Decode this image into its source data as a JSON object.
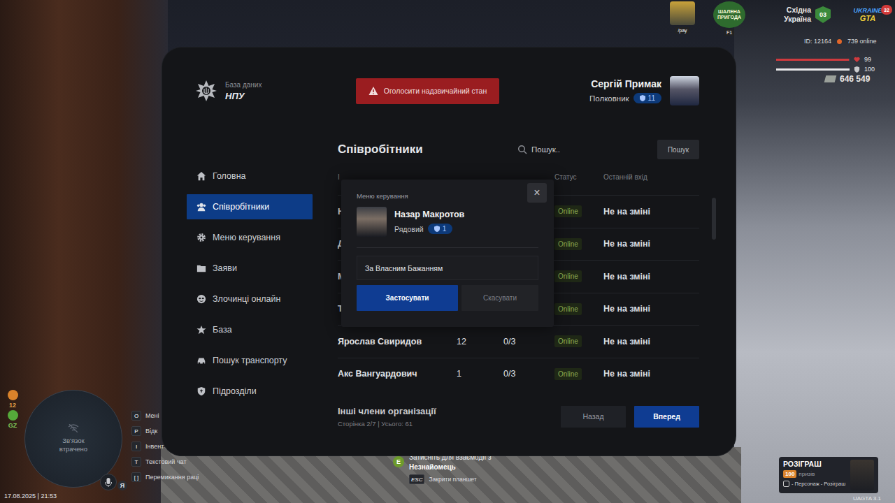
{
  "tablet": {
    "brand": {
      "subtitle": "База даних",
      "title": "НПУ"
    },
    "emergency_button": "Оголосити надзвичайний стан",
    "user": {
      "name": "Сергій Примак",
      "rank": "Полковник",
      "level": "11"
    },
    "sidebar": {
      "items": [
        {
          "label": "Головна",
          "selected": false
        },
        {
          "label": "Співробітники",
          "selected": true
        },
        {
          "label": "Меню керування",
          "selected": false
        },
        {
          "label": "Заяви",
          "selected": false
        },
        {
          "label": "Злочинці онлайн",
          "selected": false
        },
        {
          "label": "База",
          "selected": false
        },
        {
          "label": "Пошук транспорту",
          "selected": false
        },
        {
          "label": "Підрозділи",
          "selected": false
        }
      ]
    },
    "page": {
      "title": "Співробітники",
      "search": {
        "placeholder": "Пошук..",
        "button": "Пошук"
      }
    },
    "table": {
      "header": {
        "name": "І",
        "status": "Статус",
        "last_login": "Останній вхід"
      },
      "rows": [
        {
          "name": "Н",
          "status": "Online",
          "last_login": "Не на зміні"
        },
        {
          "name": "Д",
          "status": "Online",
          "last_login": "Не на зміні"
        },
        {
          "name": "М",
          "status": "Online",
          "last_login": "Не на зміні"
        },
        {
          "name": "Т",
          "status": "Online",
          "last_login": "Не на зміні"
        },
        {
          "name": "Ярослав Свиридов",
          "rank": "12",
          "warnings": "0/3",
          "status": "Online",
          "last_login": "Не на зміні"
        },
        {
          "name": "Акс Вангуардович",
          "rank": "1",
          "warnings": "0/3",
          "status": "Online",
          "last_login": "Не на зміні"
        }
      ]
    },
    "footer": {
      "title": "Інші члени організації",
      "pagination": "Сторінка 2/7 | Усього: 61",
      "prev": "Назад",
      "next": "Вперед"
    }
  },
  "modal": {
    "title": "Меню керування",
    "close": "×",
    "member": {
      "name": "Назар Макротов",
      "rank": "Рядовий",
      "level": "1"
    },
    "reason": "За Власним Бажанням",
    "apply": "Застосувати",
    "cancel": "Скасувати"
  },
  "hud": {
    "pay_label": "/pay",
    "adventure": {
      "title": "ШАЛЕНА ПРИГОДА",
      "key": "F1"
    },
    "region": {
      "name": "Східна Україна",
      "number": "03"
    },
    "logo": {
      "lines": [
        "UKRAINE",
        "GTA"
      ],
      "badge": "32"
    },
    "player_id": "ID: 12164",
    "online": "739 online",
    "health": {
      "value": "99",
      "level": 0.99
    },
    "armor": {
      "value": "100",
      "level": 1
    },
    "money": "646 549",
    "stats": [
      "12",
      "GZ"
    ],
    "minimap": "Зв'язок втрачено",
    "keys": [
      {
        "key": "O",
        "label": "Мені"
      },
      {
        "key": "P",
        "label": "Відк"
      },
      {
        "key": "I",
        "label": "Інвент"
      },
      {
        "key": "T",
        "label": "Текстовий чат"
      },
      {
        "key": "[ ]",
        "label": "Перемикання раці"
      }
    ],
    "voice": "Я",
    "datetime": "17.08.2025 | 21:53",
    "interaction": {
      "key": "E",
      "hint": "Затисніть для взаємодії з",
      "target": "Незнайомець",
      "esc_key": "ESC",
      "esc_label": "Закрити планшет"
    },
    "giveaway": {
      "title": "РОЗІГРАШ",
      "count": "100",
      "unit": "призів",
      "hint": "- Персонаж - Розіграш"
    },
    "version": "UAGTA 3.1"
  }
}
